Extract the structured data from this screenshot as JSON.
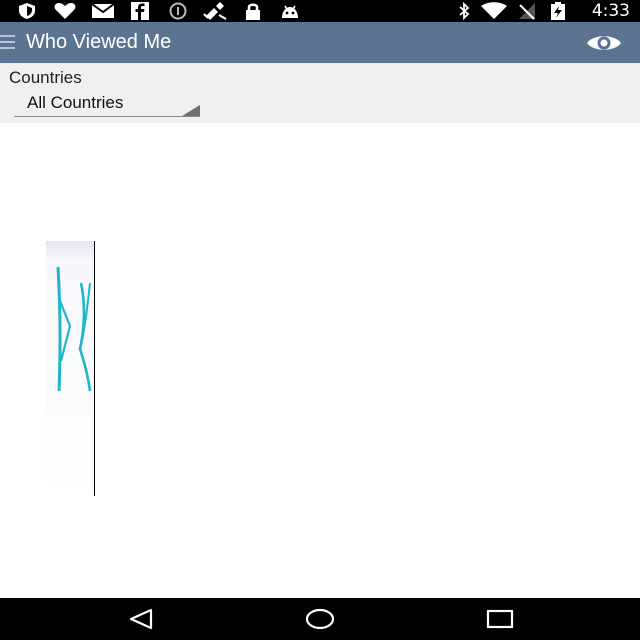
{
  "status_bar": {
    "time": "4:33",
    "left_icons": [
      "shield-icon",
      "heart-icon",
      "mail-icon",
      "facebook-icon",
      "data-saver-icon",
      "satellite-icon",
      "lock-icon",
      "android-icon"
    ],
    "right_icons": [
      "bluetooth-icon",
      "wifi-icon",
      "no-signal-icon",
      "battery-charging-icon"
    ],
    "battery_level": 0.5
  },
  "app_bar": {
    "title": "Who Viewed Me",
    "background_color": "#5c7391",
    "action_icon": "eye-icon"
  },
  "filter": {
    "label": "Countries",
    "selected": "All Countries"
  },
  "content": {
    "loading_image_icon": "partial-logo-image"
  },
  "nav_bar": {
    "buttons": [
      "back-icon",
      "home-icon",
      "recents-icon"
    ]
  }
}
